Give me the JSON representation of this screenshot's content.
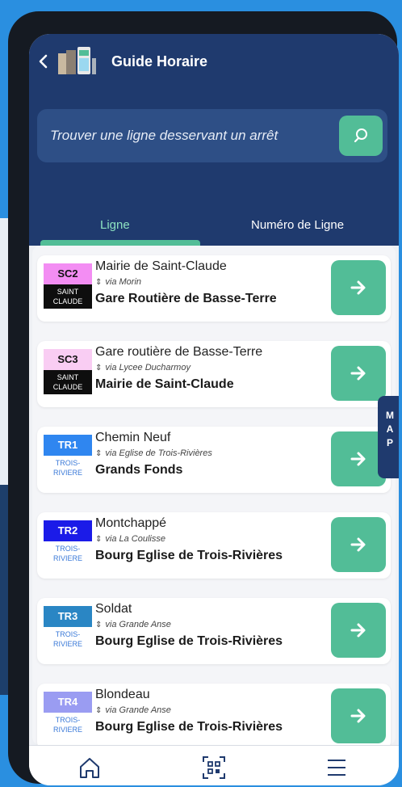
{
  "header": {
    "title": "Guide Horaire",
    "search_placeholder": "Trouver une ligne desservant un arrêt"
  },
  "tabs": [
    {
      "label": "Ligne",
      "active": true
    },
    {
      "label": "Numéro de Ligne",
      "active": false
    }
  ],
  "map_tab": [
    "M",
    "A",
    "P"
  ],
  "lines": [
    {
      "code": "SC2",
      "badge_color": "#f38df3",
      "city": "SAINT CLAUDE",
      "city_style": "dark",
      "origin": "Mairie de Saint-Claude",
      "via": "via Morin",
      "destination": "Gare Routière de Basse-Terre"
    },
    {
      "code": "SC3",
      "badge_color": "#f9cdf3",
      "city": "SAINT CLAUDE",
      "city_style": "dark",
      "origin": "Gare routière de Basse-Terre",
      "via": "via Lycee Ducharmoy",
      "destination": "Mairie de Saint-Claude"
    },
    {
      "code": "TR1",
      "badge_color": "#2f86f0",
      "city": "TROIS-RIVIERE",
      "city_style": "light",
      "origin": "Chemin Neuf",
      "via": "via Eglise de Trois-Rivières",
      "destination": "Grands Fonds"
    },
    {
      "code": "TR2",
      "badge_color": "#1b1be8",
      "city": "TROIS-RIVIERE",
      "city_style": "light",
      "origin": "Montchappé",
      "via": "via La Coulisse",
      "destination": "Bourg Eglise de Trois-Rivières"
    },
    {
      "code": "TR3",
      "badge_color": "#2a86c4",
      "city": "TROIS-RIVIERE",
      "city_style": "light",
      "origin": "Soldat",
      "via": "via Grande Anse",
      "destination": "Bourg Eglise de Trois-Rivières"
    },
    {
      "code": "TR4",
      "badge_color": "#9a9cf2",
      "city": "TROIS-RIVIERE",
      "city_style": "light",
      "origin": "Blondeau",
      "via": "via Grande Anse",
      "destination": "Bourg Eglise de Trois-Rivières"
    }
  ],
  "bottom_nav": [
    {
      "icon": "home-icon"
    },
    {
      "icon": "qr-code-icon"
    },
    {
      "icon": "menu-icon"
    }
  ],
  "colors": {
    "header": "#1f3a6e",
    "accent": "#52bd97",
    "background": "#2a8fe0"
  }
}
